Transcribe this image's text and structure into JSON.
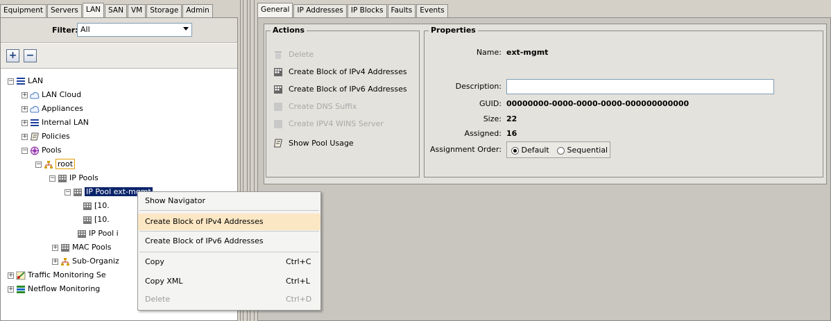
{
  "left_tabs": [
    "Equipment",
    "Servers",
    "LAN",
    "SAN",
    "VM",
    "Storage",
    "Admin"
  ],
  "active_left_tab": "LAN",
  "filter": {
    "label": "Filter:",
    "value": "All"
  },
  "toolbar": {
    "expand_label": "+",
    "collapse_label": "−"
  },
  "tree": {
    "lan": "LAN",
    "lan_cloud": "LAN Cloud",
    "appliances": "Appliances",
    "internal_lan": "Internal LAN",
    "policies": "Policies",
    "pools": "Pools",
    "root": "root",
    "ip_pools": "IP Pools",
    "ip_pool_ext_mgmt": "IP Pool ext-mgmt",
    "block_1": "[10.",
    "block_2": "[10.",
    "ip_pool_i": "IP Pool i",
    "mac_pools": "MAC Pools",
    "sub_orgs": "Sub-Organiz",
    "traffic_monitoring": "Traffic Monitoring Se",
    "netflow_monitoring": "Netflow Monitoring"
  },
  "right_tabs": [
    "General",
    "IP Addresses",
    "IP Blocks",
    "Faults",
    "Events"
  ],
  "active_right_tab": "General",
  "actions": {
    "title": "Actions",
    "delete": "Delete",
    "create_ipv4": "Create Block of IPv4 Addresses",
    "create_ipv6": "Create Block of IPv6 Addresses",
    "create_dns": "Create DNS Suffix",
    "create_wins": "Create IPV4 WINS Server",
    "show_usage": "Show Pool Usage"
  },
  "properties": {
    "title": "Properties",
    "name_label": "Name:",
    "name_value": "ext-mgmt",
    "description_label": "Description:",
    "description_value": "",
    "guid_label": "GUID:",
    "guid_value": "00000000-0000-0000-0000-000000000000",
    "size_label": "Size:",
    "size_value": "22",
    "assigned_label": "Assigned:",
    "assigned_value": "16",
    "assignment_order_label": "Assignment Order:",
    "order_default": "Default",
    "order_sequential": "Sequential",
    "selected_order": "Default"
  },
  "context_menu": {
    "show_navigator": "Show Navigator",
    "create_ipv4": "Create Block of IPv4 Addresses",
    "create_ipv6": "Create Block of IPv6 Addresses",
    "copy": "Copy",
    "copy_shortcut": "Ctrl+C",
    "copy_xml": "Copy XML",
    "copy_xml_shortcut": "Ctrl+L",
    "delete": "Delete",
    "delete_shortcut": "Ctrl+D"
  },
  "colors": {
    "selection": "#0a246a",
    "menu_highlight": "#fce7c4",
    "lan_icon": "#1a3d9c",
    "pools_icon": "#8a2aa0",
    "org_icon": "#d4a000"
  }
}
